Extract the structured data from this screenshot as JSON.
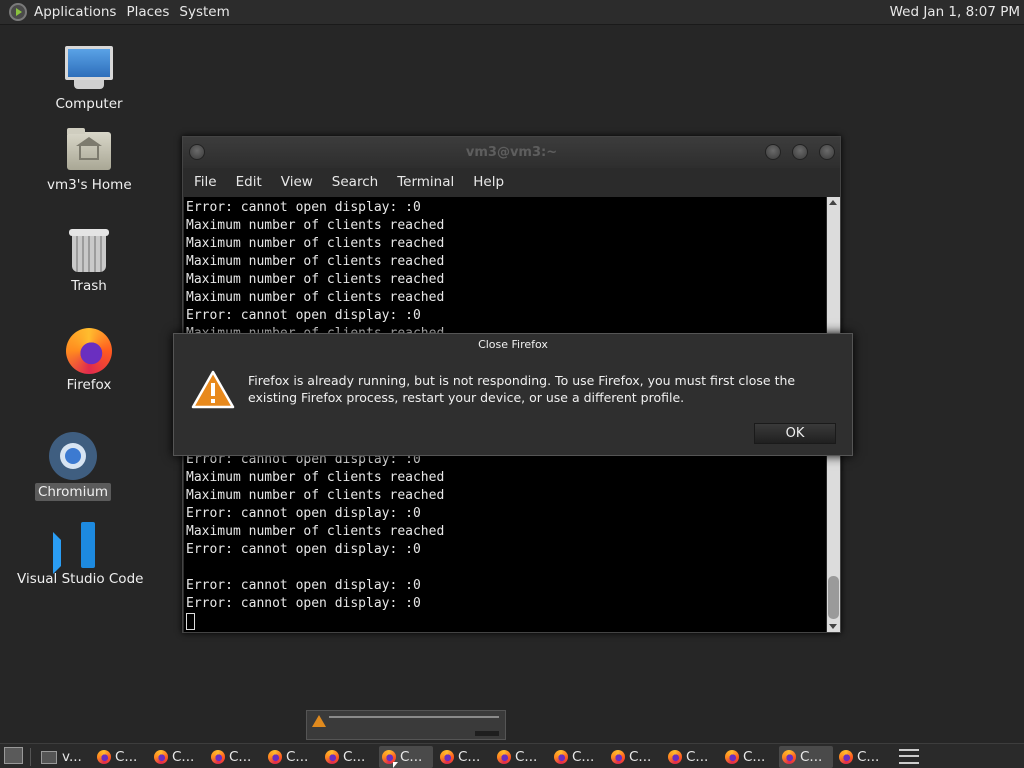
{
  "top_panel": {
    "menus": [
      "Applications",
      "Places",
      "System"
    ],
    "clock": "Wed Jan  1,  8:07 PM"
  },
  "desktop_icons": {
    "computer": "Computer",
    "home": "vm3's Home",
    "trash": "Trash",
    "firefox": "Firefox",
    "chromium": "Chromium",
    "vscode": "Visual Studio Code"
  },
  "terminal": {
    "title": "vm3@vm3:~",
    "menu": [
      "File",
      "Edit",
      "View",
      "Search",
      "Terminal",
      "Help"
    ],
    "lines": [
      "Error: cannot open display: :0",
      "Maximum number of clients reached",
      "Maximum number of clients reached",
      "Maximum number of clients reached",
      "Maximum number of clients reached",
      "Maximum number of clients reached",
      "Error: cannot open display: :0",
      "Maximum number of clients reached",
      "",
      "",
      "",
      "",
      "",
      "",
      "Error: cannot open display: :0",
      "Maximum number of clients reached",
      "Maximum number of clients reached",
      "Error: cannot open display: :0",
      "Maximum number of clients reached",
      "Error: cannot open display: :0",
      "",
      "Error: cannot open display: :0",
      "Error: cannot open display: :0"
    ]
  },
  "dialog": {
    "title": "Close Firefox",
    "message": "Firefox is already running, but is not responding. To use Firefox, you must first close the existing Firefox process, restart your device, or use a different profile.",
    "ok_label": "OK"
  },
  "taskbar": {
    "terminal_item": "v...",
    "firefox_item": "C..."
  }
}
